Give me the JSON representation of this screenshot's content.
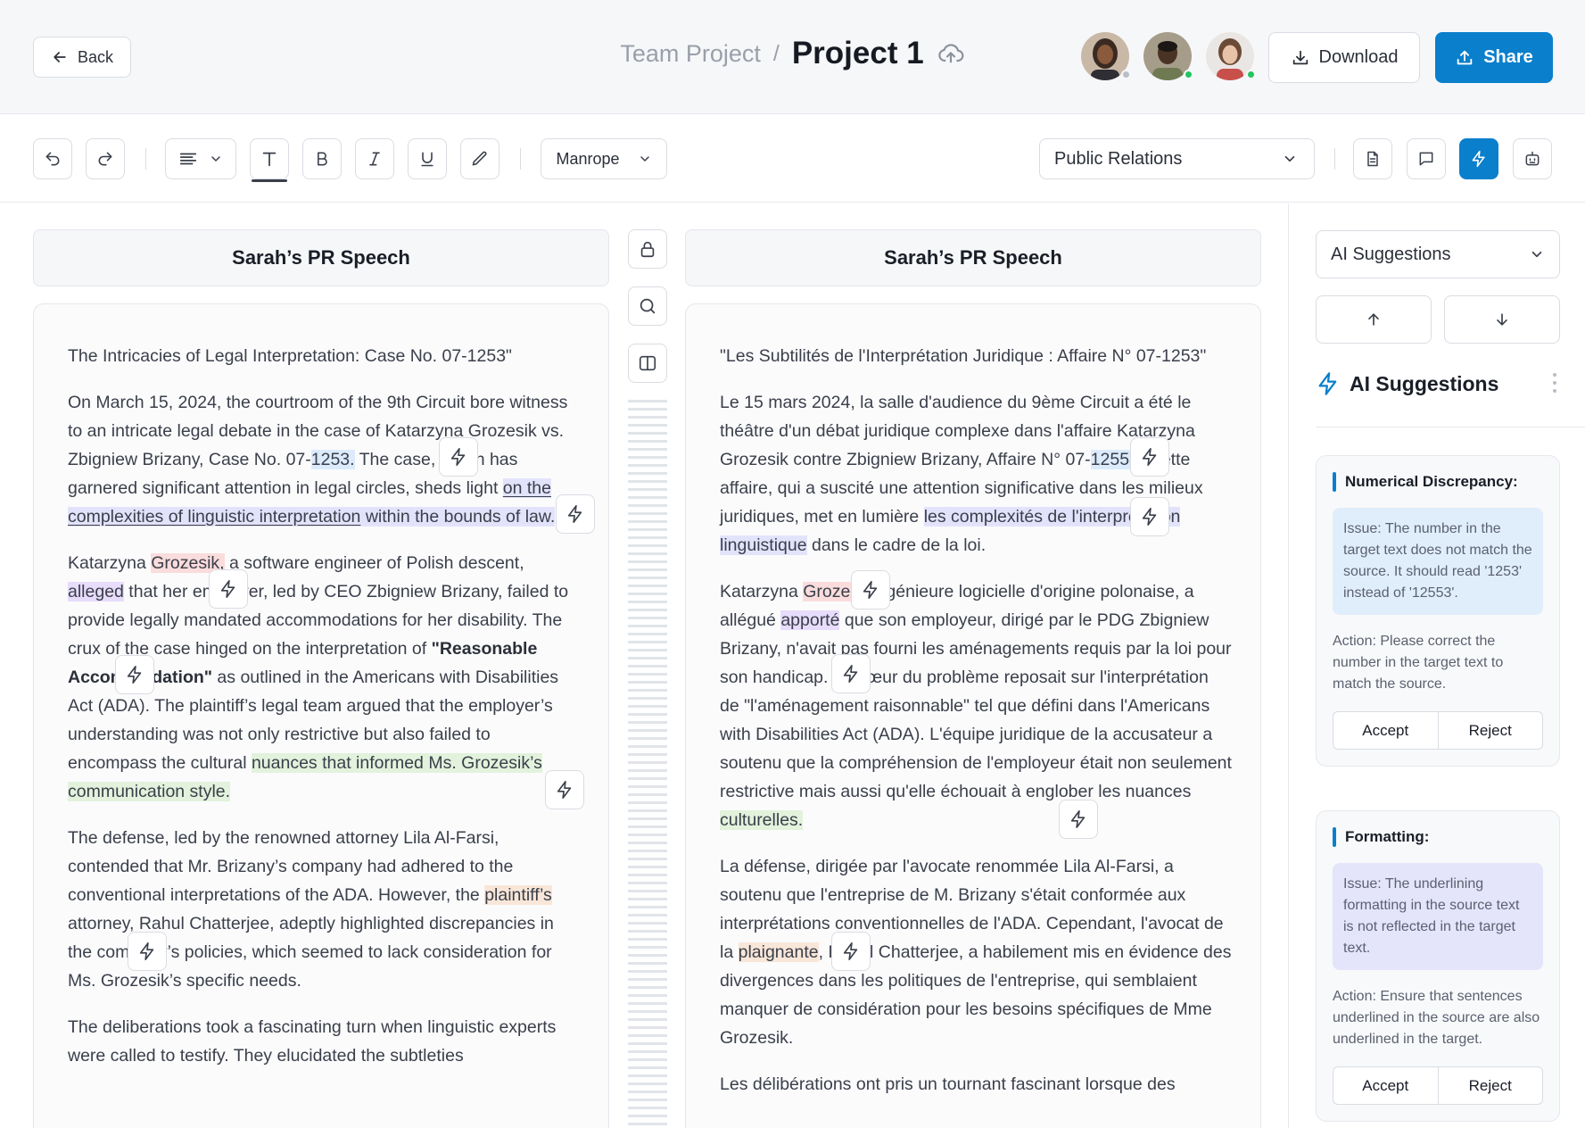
{
  "header": {
    "back_label": "Back",
    "breadcrumb_team": "Team Project",
    "breadcrumb_sep": "/",
    "project_title": "Project 1",
    "download_label": "Download",
    "share_label": "Share",
    "avatars": [
      {
        "status_color": "#b9bec7"
      },
      {
        "status_color": "#22c55e"
      },
      {
        "status_color": "#22c55e"
      }
    ]
  },
  "toolbar": {
    "font_name": "Manrope",
    "category": "Public Relations",
    "active_color": "#0a7fcc"
  },
  "source": {
    "title": "Sarah’s PR Speech",
    "heading": "The Intricacies of Legal Interpretation: Case No. 07-1253\"",
    "p1": {
      "a": "On March 15, 2024, the courtroom of the 9th Circuit bore witness to an intricate legal debate in the case of Katarzyna Grozesik vs. Zbigniew Brizany, Case No. 07-",
      "num": "1253.",
      "b": " The case, which has garnered significant attention in legal circles, sheds light ",
      "hl_ul": "on the complexities of linguistic interpretation",
      "hl_rest": " within the bounds of law."
    },
    "p2": {
      "a": "Katarzyna ",
      "name": "Grozesik,",
      "b": " a software engineer of Polish descent, ",
      "alleged": "alleged",
      "c": " that her employer, led by CEO Zbigniew Brizany, failed to provide legally mandated accommodations for her disability. The crux of the case hinged on the interpretation of ",
      "strong": "\"Reasonable Accommodation\"",
      "d": " as outlined in the Americans with Disabilities Act (ADA). The plaintiff’s legal team argued that the employer’s understanding was not only restrictive but also failed to encompass the cultural ",
      "green": "nuances that informed Ms. Grozesik’s communication style."
    },
    "p3": {
      "a": "The defense, led by the renowned attorney Lila Al-Farsi, contended that Mr. Brizany’s company had adhered to the conventional interpretations of the ADA. However, the ",
      "orange": "plaintiff’s",
      "b": " attorney, Rahul Chatterjee, adeptly highlighted discrepancies in the company’s policies, which seemed to lack consideration for Ms. Grozesik’s specific needs."
    },
    "p4": "The deliberations took a fascinating turn when linguistic experts were called to testify. They elucidated the subtleties"
  },
  "target": {
    "title": "Sarah’s PR Speech",
    "heading": "\"Les Subtilités de l'Interprétation Juridique : Affaire N° 07-1253\"",
    "p1": {
      "a": "Le 15 mars 2024, la salle d'audience du 9ème Circuit a été le théâtre d'un débat juridique complexe dans l'affaire Katarzyna Grozesik contre Zbigniew Brizany, Affaire N° 07-",
      "num": "12553",
      "b": ". Cette affaire, qui a suscité une attention significative dans les milieux juridiques, met en lumière ",
      "hl": "les complexités de l'interprétation linguistique",
      "c": " dans le cadre de la loi."
    },
    "p2": {
      "a": "Katarzyna ",
      "name": "Grozeik",
      "b": ", ingénieure logicielle d'origine polonaise, a allégué ",
      "apporte": "apporté",
      "c": " que son employeur, dirigé par le PDG Zbigniew Brizany, n'avait pas fourni les aménagements requis par la loi pour son handicap. Le cœur du problème reposait sur l'interprétation de \"l'aménagement raisonnable\" tel que défini dans l'Americans with Disabilities Act (ADA). L'équipe juridique de la accusateur a soutenu que la compréhension de l'employeur était non seulement restrictive mais aussi qu'elle échouait à englober les nuances ",
      "green": "culturelles."
    },
    "p3": {
      "a": "La défense, dirigée par l'avocate renommée Lila Al-Farsi, a soutenu que l'entreprise de M. Brizany s'était conformée aux interprétations conventionnelles de l'ADA. Cependant, l'avocat de la ",
      "orange": "plaignante",
      "b": ", Rahul Chatterjee, a habilement mis en évidence des divergences dans les politiques de l'entreprise, qui semblaient manquer de considération pour les besoins spécifiques de Mme Grozesik."
    },
    "p4": "Les délibérations ont pris un tournant fascinant lorsque des"
  },
  "sidebar": {
    "select_label": "AI Suggestions",
    "heading": "AI Suggestions",
    "cards": [
      {
        "title": "Numerical Discrepancy:",
        "issue": "Issue: The number in the target text does not match the source. It should read '1253' instead of '12553'.",
        "action": "Action: Please correct the number in the target text to match the source.",
        "accept": "Accept",
        "reject": "Reject",
        "issue_bg": "#e0eefb"
      },
      {
        "title": "Formatting:",
        "issue": "Issue: The underlining formatting in the source text is not reflected in the target text.",
        "action": "Action: Ensure that sentences underlined in the source are also underlined in the target.",
        "accept": "Accept",
        "reject": "Reject",
        "issue_bg": "#e4e4fb"
      }
    ]
  }
}
